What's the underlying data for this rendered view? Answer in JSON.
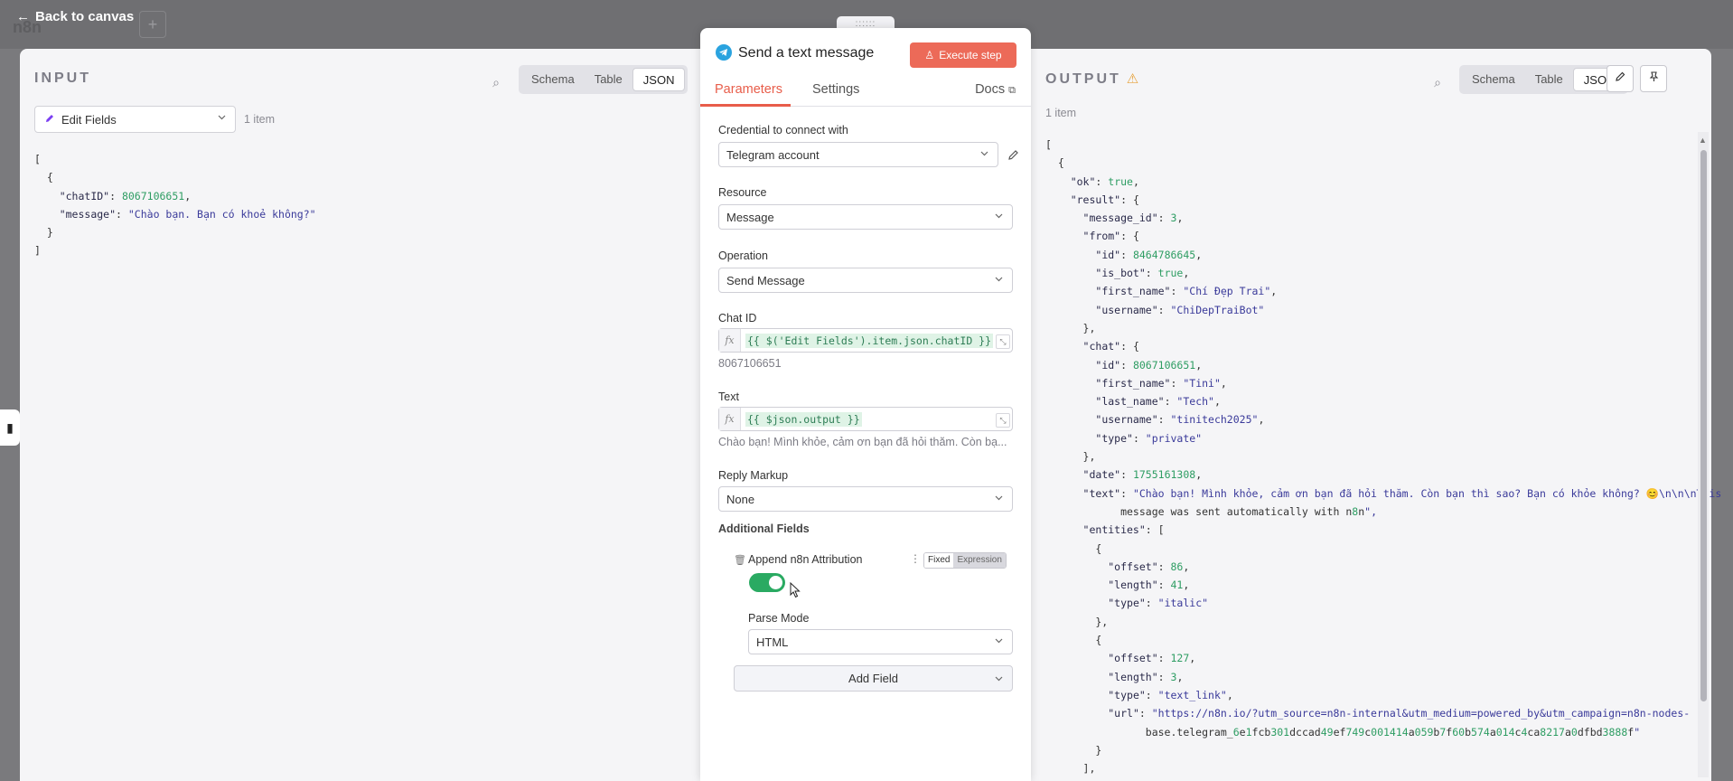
{
  "app": {
    "back_label": "Back to canvas",
    "logo": "n8n",
    "plus": "+"
  },
  "input": {
    "title": "INPUT",
    "views": [
      "Schema",
      "Table",
      "JSON"
    ],
    "active_view": "JSON",
    "node_select": "Edit Fields",
    "item_count": "1 item",
    "json_lines": [
      "[",
      "  {",
      "    \"chatID\": 8067106651,",
      "    \"message\": \"Chào bạn. Bạn có khoẻ không?\"",
      "  }",
      "]"
    ]
  },
  "output": {
    "title": "OUTPUT",
    "views": [
      "Schema",
      "Table",
      "JSON"
    ],
    "active_view": "JSON",
    "item_count": "1 item",
    "json_lines": [
      "[",
      "  {",
      "    \"ok\": true,",
      "    \"result\": {",
      "      \"message_id\": 3,",
      "      \"from\": {",
      "        \"id\": 8464786645,",
      "        \"is_bot\": true,",
      "        \"first_name\": \"Chí Đẹp Trai\",",
      "        \"username\": \"ChiDepTraiBot\"",
      "      },",
      "      \"chat\": {",
      "        \"id\": 8067106651,",
      "        \"first_name\": \"Tini\",",
      "        \"last_name\": \"Tech\",",
      "        \"username\": \"tinitech2025\",",
      "        \"type\": \"private\"",
      "      },",
      "      \"date\": 1755161308,",
      "      \"text\": \"Chào bạn! Mình khỏe, cảm ơn bạn đã hỏi thăm. Còn bạn thì sao? Bạn có khỏe không? 😊\\n\\n\\nThis",
      "            message was sent automatically with n8n\",",
      "      \"entities\": [",
      "        {",
      "          \"offset\": 86,",
      "          \"length\": 41,",
      "          \"type\": \"italic\"",
      "        },",
      "        {",
      "          \"offset\": 127,",
      "          \"length\": 3,",
      "          \"type\": \"text_link\",",
      "          \"url\": \"https://n8n.io/?utm_source=n8n-internal&utm_medium=powered_by&utm_campaign=n8n-nodes-",
      "                base.telegram_6e1fcb301dccad49ef749c001414a059b7f60b574a014c4ca8217a0dfbd3888f\"",
      "        }",
      "      ],"
    ]
  },
  "node": {
    "handle": "::::::",
    "title": "Send a text message",
    "execute_label": "Execute step",
    "tabs": [
      "Parameters",
      "Settings"
    ],
    "active_tab": "Parameters",
    "docs_label": "Docs",
    "credential_label": "Credential to connect with",
    "credential_value": "Telegram account",
    "resource_label": "Resource",
    "resource_value": "Message",
    "operation_label": "Operation",
    "operation_value": "Send Message",
    "chat_id_label": "Chat ID",
    "chat_id_expr": "{{ $('Edit Fields').item.json.chatID }}",
    "chat_id_preview": "8067106651",
    "text_label": "Text",
    "text_expr": "{{ $json.output }}",
    "text_preview": "Chào bạn! Mình khỏe, cảm ơn bạn đã hỏi thăm. Còn bạ...",
    "reply_markup_label": "Reply Markup",
    "reply_markup_value": "None",
    "additional_fields_label": "Additional Fields",
    "append_label": "Append n8n Attribution",
    "fixed_label": "Fixed",
    "expression_label": "Expression",
    "append_enabled": true,
    "parse_mode_label": "Parse Mode",
    "parse_mode_value": "HTML",
    "add_field_label": "Add Field"
  },
  "colors": {
    "accent": "#e85d4a",
    "execute": "#ec6a58",
    "toggle_on": "#2aaa62",
    "number": "#2e9d63",
    "string": "#3a3a9a"
  }
}
